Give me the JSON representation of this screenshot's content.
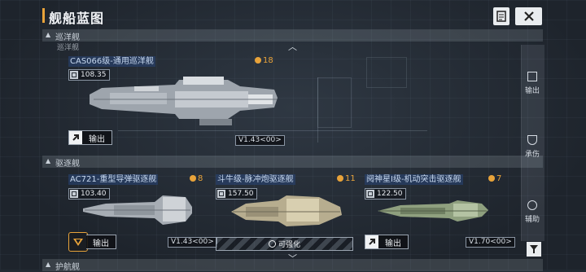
{
  "header": {
    "title": "舰船蓝图",
    "doc_icon": "document-icon",
    "close_icon": "close-icon"
  },
  "sections": {
    "cruiser": {
      "label": "巡洋舰",
      "top_label": "巡洋舰"
    },
    "destroyer": {
      "label": "驱逐舰"
    },
    "frigate": {
      "label": "护航舰"
    }
  },
  "ships": [
    {
      "name": "CAS066级-通用巡洋舰",
      "stat": "108.35",
      "level": "18",
      "export_label": "输出",
      "version": "V1.43<00>"
    },
    {
      "name": "AC721-重型导弹驱逐舰",
      "stat": "103.40",
      "level": "8",
      "export_label": "输出",
      "version": "V1.43<00>"
    },
    {
      "name": "斗牛级-脉冲炮驱逐舰",
      "stat": "157.50",
      "level": "11",
      "enhance_label": "可强化"
    },
    {
      "name": "阋神星I级-机动突击驱逐舰",
      "stat": "122.50",
      "level": "7",
      "export_label": "输出",
      "version": "V1.70<00>"
    }
  ],
  "side_panel": {
    "items": [
      {
        "label": "输出",
        "icon": "arrow-out-icon"
      },
      {
        "label": "承伤",
        "icon": "shield-icon"
      },
      {
        "label": "辅助",
        "icon": "support-icon"
      }
    ],
    "filter_icon": "filter-icon"
  },
  "colors": {
    "accent": "#e8a33a",
    "background": "#232a33",
    "text": "#e6e9ee"
  }
}
